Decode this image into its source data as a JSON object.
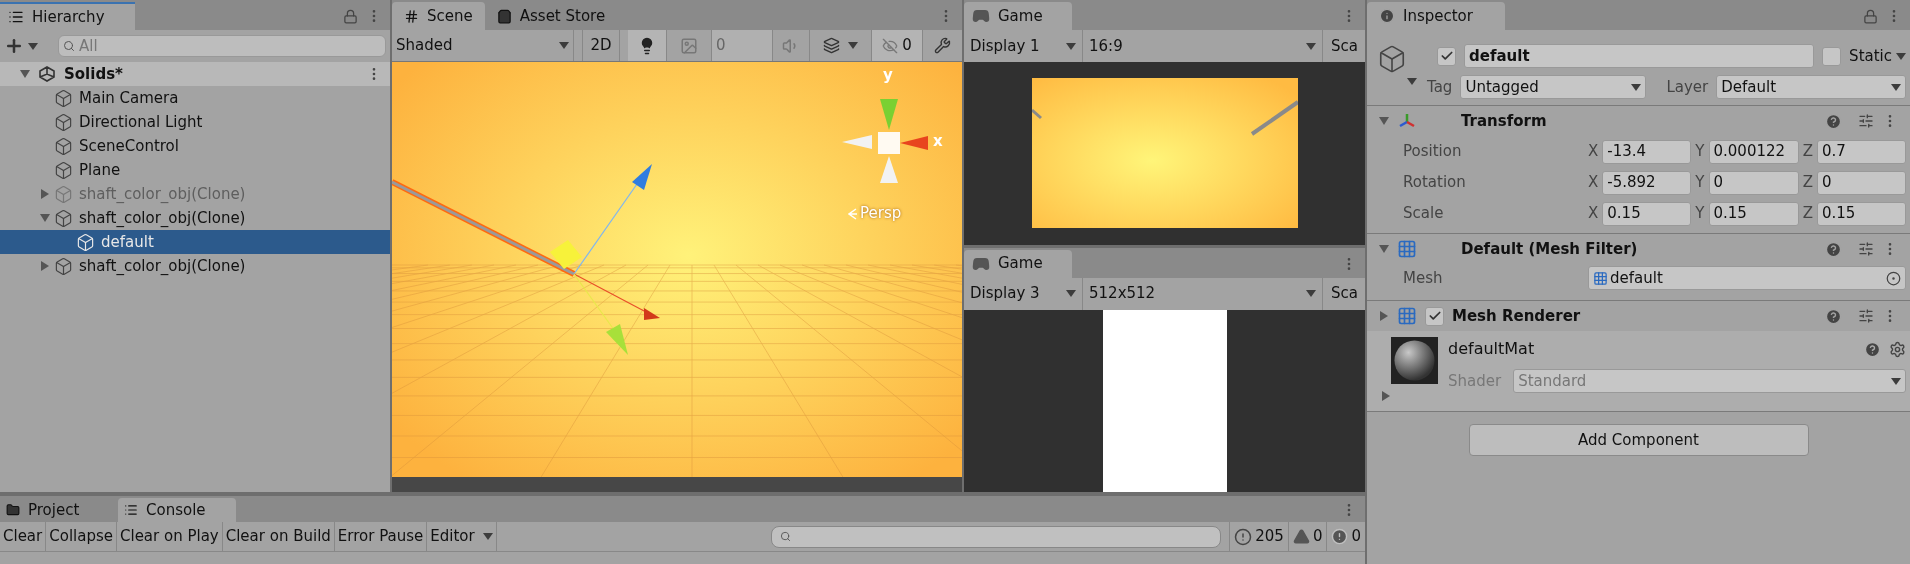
{
  "hierarchy": {
    "title": "Hierarchy",
    "search": {
      "placeholder": "All"
    },
    "scene": {
      "name": "Solids*",
      "expanded": true
    },
    "items": [
      {
        "name": "Main Camera",
        "active": true,
        "selected": false
      },
      {
        "name": "Directional Light",
        "active": true,
        "selected": false
      },
      {
        "name": "SceneControl",
        "active": true,
        "selected": false
      },
      {
        "name": "Plane",
        "active": true,
        "selected": false
      },
      {
        "name": "shaft_color_obj(Clone)",
        "active": false,
        "selected": false,
        "expanded": false
      },
      {
        "name": "shaft_color_obj(Clone)",
        "active": true,
        "selected": false,
        "expanded": true,
        "children": [
          {
            "name": "default",
            "active": true,
            "selected": true
          }
        ]
      },
      {
        "name": "shaft_color_obj(Clone)",
        "active": true,
        "selected": false,
        "expanded": false
      }
    ]
  },
  "scene": {
    "tabs": [
      {
        "label": "Scene",
        "kind": "scene",
        "selected": true
      },
      {
        "label": "Asset Store",
        "kind": "store",
        "selected": false
      }
    ],
    "shading": "Shaded",
    "mode_2d": {
      "label": "2D",
      "on": false
    },
    "lighting": {
      "on": true
    },
    "camera_field": "0",
    "hidden_count": "0",
    "gizmo": {
      "y": "y",
      "x": "x",
      "projection": "Persp"
    }
  },
  "games": [
    {
      "tab": "Game",
      "display": "Display 1",
      "resolution": "16:9",
      "scale": "Sca",
      "kind": "scene"
    },
    {
      "tab": "Game",
      "display": "Display 3",
      "resolution": "512x512",
      "scale": "Sca",
      "kind": "white"
    }
  ],
  "inspector": {
    "title": "Inspector",
    "active": true,
    "name": "default",
    "static": {
      "label": "Static",
      "checked": false
    },
    "tag": {
      "label": "Tag",
      "value": "Untagged"
    },
    "layer": {
      "label": "Layer",
      "value": "Default"
    },
    "transform": {
      "title": "Transform",
      "expanded": true,
      "rows": [
        {
          "label": "Position",
          "fields": [
            {
              "axis": "X",
              "value": "-13.4"
            },
            {
              "axis": "Y",
              "value": "0.000122"
            },
            {
              "axis": "Z",
              "value": "0.7"
            }
          ]
        },
        {
          "label": "Rotation",
          "fields": [
            {
              "axis": "X",
              "value": "-5.892"
            },
            {
              "axis": "Y",
              "value": "0"
            },
            {
              "axis": "Z",
              "value": "0"
            }
          ]
        },
        {
          "label": "Scale",
          "fields": [
            {
              "axis": "X",
              "value": "0.15"
            },
            {
              "axis": "Y",
              "value": "0.15"
            },
            {
              "axis": "Z",
              "value": "0.15"
            }
          ]
        }
      ]
    },
    "mesh_filter": {
      "title": "Default (Mesh Filter)",
      "expanded": true,
      "label": "Mesh",
      "value": "default"
    },
    "mesh_renderer": {
      "title": "Mesh Renderer",
      "expanded": false,
      "enabled": true
    },
    "material": {
      "name": "defaultMat",
      "expanded": false,
      "shader_label": "Shader",
      "shader": "Standard"
    },
    "add_button": "Add Component"
  },
  "console": {
    "tabs": [
      {
        "label": "Project",
        "kind": "project",
        "selected": false
      },
      {
        "label": "Console",
        "kind": "console",
        "selected": true
      }
    ],
    "buttons": [
      {
        "label": "Clear",
        "kind": "button"
      },
      {
        "label": "Collapse",
        "kind": "button"
      },
      {
        "label": "Clear on Play",
        "kind": "button"
      },
      {
        "label": "Clear on Build",
        "kind": "button"
      },
      {
        "label": "Error Pause",
        "kind": "button"
      },
      {
        "label": "Editor",
        "kind": "dropdown"
      }
    ],
    "counts": [
      {
        "kind": "info",
        "value": "205"
      },
      {
        "kind": "warning",
        "value": "0"
      },
      {
        "kind": "error",
        "value": "0"
      }
    ]
  }
}
